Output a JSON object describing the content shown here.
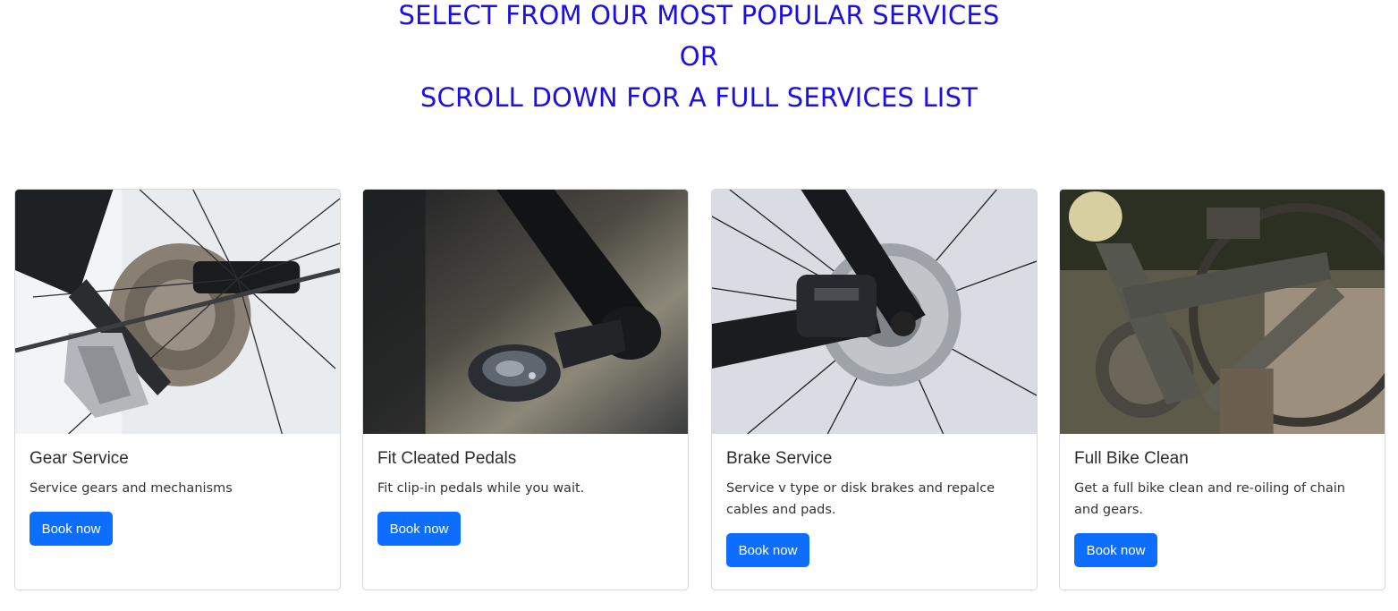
{
  "heading": {
    "line1": "SELECT FROM OUR MOST POPULAR SERVICES",
    "line2": "OR",
    "line3": "SCROLL DOWN FOR A FULL SERVICES LIST"
  },
  "cards": [
    {
      "title": "Gear Service",
      "description": "Service gears and mechanisms",
      "button": "Book now",
      "image": "bicycle rear derailleur and cassette"
    },
    {
      "title": "Fit Cleated Pedals",
      "description": "Fit clip-in pedals while you wait.",
      "button": "Book now",
      "image": "clipless pedal on crank arm"
    },
    {
      "title": "Brake Service",
      "description": "Service v type or disk brakes and repalce cables and pads.",
      "button": "Book now",
      "image": "disc brake caliper and rotor"
    },
    {
      "title": "Full Bike Clean",
      "description": "Get a full bike clean and re-oiling of chain and gears.",
      "button": "Book now",
      "image": "muddy bike frame and chainring"
    }
  ],
  "colors": {
    "heading": "#1b0fe6",
    "button": "#0d6efd",
    "card_border": "#d7d7d7"
  }
}
